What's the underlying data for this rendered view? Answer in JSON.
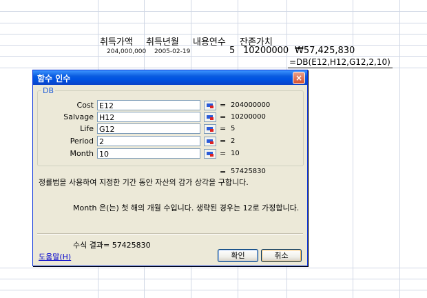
{
  "sheet": {
    "headers": [
      "취득가액",
      "취득년월",
      "내용연수",
      "잔존가치"
    ],
    "row_values": {
      "cost": "204,000,000",
      "date": "2005-02-19",
      "life": "5",
      "salvage": "10200000",
      "result": "₩57,425,830"
    },
    "editing_formula": "=DB(E12,H12,G12,2,10)"
  },
  "dialog": {
    "title": "함수 인수",
    "close_icon": "×",
    "function_name": "DB",
    "args": [
      {
        "label": "Cost",
        "input": "E12",
        "value": "204000000"
      },
      {
        "label": "Salvage",
        "input": "H12",
        "value": "10200000"
      },
      {
        "label": "Life",
        "input": "G12",
        "value": "5"
      },
      {
        "label": "Period",
        "input": "2",
        "value": "2"
      },
      {
        "label": "Month",
        "input": "10",
        "value": "10"
      }
    ],
    "equals": "=",
    "result_value": "57425830",
    "description": "정률법을 사용하여 지정한 기간 동안 자산의 감가 상각을 구합니다.",
    "arg_description": "Month 은(는) 첫 해의 개월 수입니다. 생략된 경우는 12로 가정합니다.",
    "formula_result": "수식 결과= 57425830",
    "help_link": "도움말(H)",
    "ok_label": "확인",
    "cancel_label": "취소"
  }
}
